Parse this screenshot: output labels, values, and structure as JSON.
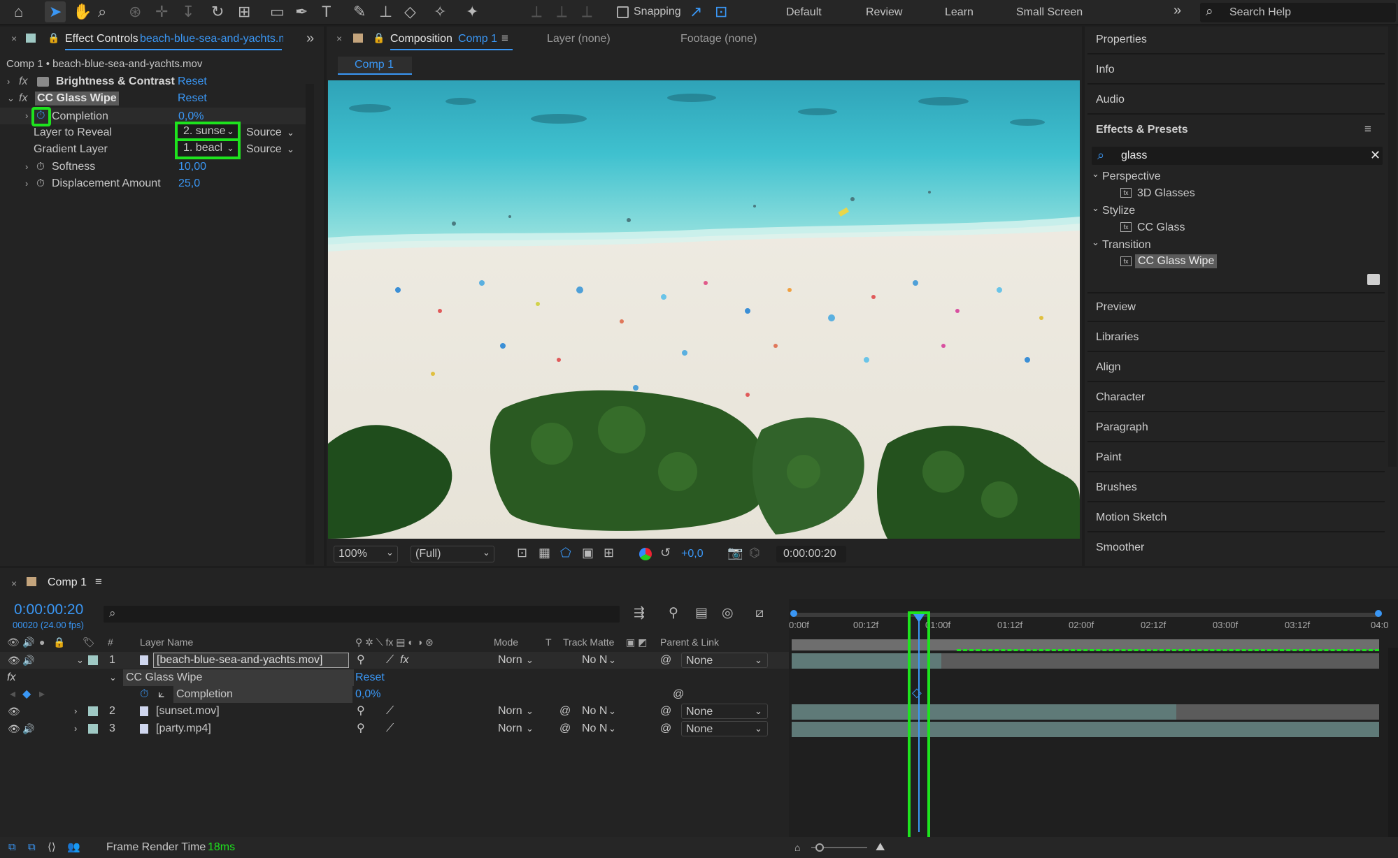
{
  "toolbar": {
    "snapping_label": "Snapping",
    "workspaces": [
      "Default",
      "Review",
      "Learn",
      "Small Screen"
    ],
    "search_placeholder": "Search Help"
  },
  "effect_controls": {
    "tab_title": "Effect Controls",
    "tab_layer": "beach-blue-sea-and-yachts.m",
    "subtitle": "Comp 1 • beach-blue-sea-and-yachts.mov",
    "fx_label": "fx",
    "effects": [
      {
        "name": "Brightness & Contrast",
        "reset": "Reset"
      },
      {
        "name": "CC Glass Wipe",
        "reset": "Reset"
      }
    ],
    "props": {
      "completion": {
        "label": "Completion",
        "value": "0,0%"
      },
      "layer_to_reveal": {
        "label": "Layer to Reveal",
        "value": "2. sunse",
        "source": "Source"
      },
      "gradient_layer": {
        "label": "Gradient Layer",
        "value": "1. beacl",
        "source": "Source"
      },
      "softness": {
        "label": "Softness",
        "value": "10,00"
      },
      "displacement": {
        "label": "Displacement Amount",
        "value": "25,0"
      }
    }
  },
  "composition": {
    "tab_title": "Composition",
    "tab_comp": "Comp 1",
    "layer_tab": "Layer (none)",
    "footage_tab": "Footage (none)",
    "comp_chip": "Comp 1",
    "zoom": "100%",
    "resolution": "(Full)",
    "exposure": "+0,0",
    "timecode": "0:00:00:20"
  },
  "right_panel": {
    "top_items": [
      "Properties",
      "Info",
      "Audio"
    ],
    "effects_presets_title": "Effects & Presets",
    "search_value": "glass",
    "tree": [
      {
        "category": "Perspective",
        "item": "3D Glasses"
      },
      {
        "category": "Stylize",
        "item": "CC Glass"
      },
      {
        "category": "Transition",
        "item": "CC Glass Wipe"
      }
    ],
    "bottom_items": [
      "Preview",
      "Libraries",
      "Align",
      "Character",
      "Paragraph",
      "Paint",
      "Brushes",
      "Motion Sketch",
      "Smoother"
    ]
  },
  "timeline": {
    "tab_title": "Comp 1",
    "timecode": "0:00:00:20",
    "fps": "00020 (24.00 fps)",
    "columns": {
      "hash": "#",
      "layer_name": "Layer Name",
      "mode": "Mode",
      "t": "T",
      "track_matte": "Track Matte",
      "parent_link": "Parent & Link"
    },
    "layers": [
      {
        "num": "1",
        "name": "[beach-blue-sea-and-yachts.mov]",
        "mode": "Norn",
        "matte": "No N",
        "parent": "None"
      },
      {
        "num": "2",
        "name": "[sunset.mov]",
        "mode": "Norn",
        "matte": "No N",
        "parent": "None"
      },
      {
        "num": "3",
        "name": "[party.mp4]",
        "mode": "Norn",
        "matte": "No N",
        "parent": "None"
      }
    ],
    "effect_row": {
      "name": "CC Glass Wipe",
      "reset": "Reset"
    },
    "completion_row": {
      "label": "Completion",
      "value": "0,0%"
    },
    "ruler": [
      "0:00f",
      "00:12f",
      "01:00f",
      "01:12f",
      "02:00f",
      "02:12f",
      "03:00f",
      "03:12f",
      "04:0"
    ]
  },
  "status": {
    "label": "Frame Render Time",
    "value": "18ms"
  },
  "colors": {
    "accent": "#3a97f5",
    "highlight": "#1ee31e",
    "panel": "#232323",
    "bar": "#5f7a78"
  }
}
